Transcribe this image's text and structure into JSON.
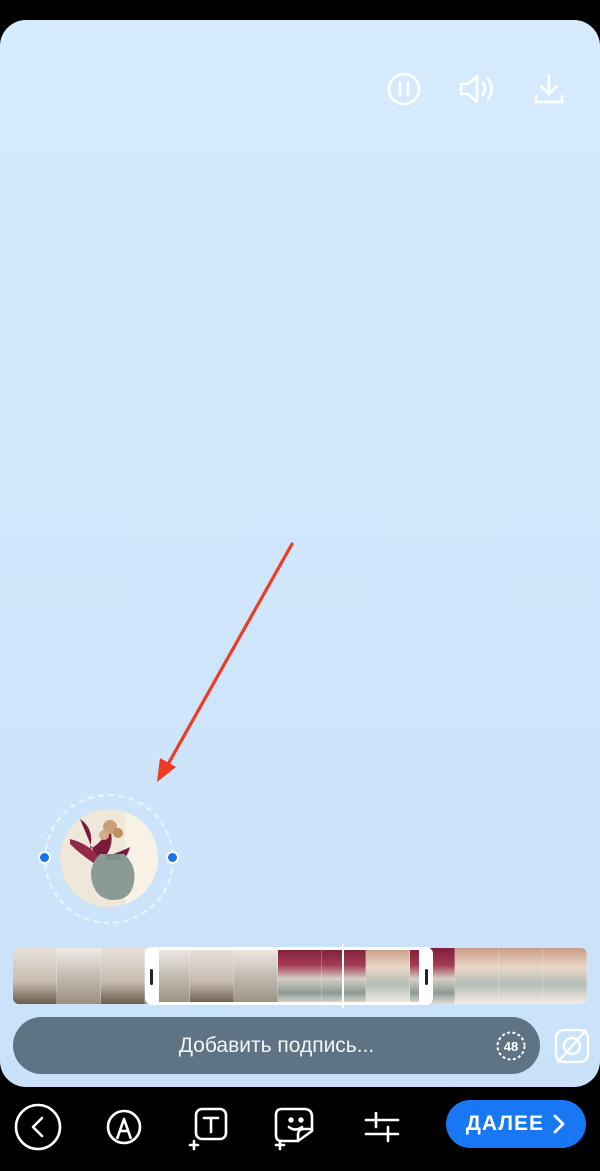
{
  "colors": {
    "canvas_top": "#d6ebfd",
    "canvas_bottom": "#c9e2fa",
    "accent": "#1877f2",
    "arrow": "#ef3a24",
    "caption_bg": "#5e7384"
  },
  "top_controls": [
    "pause-icon",
    "sound-icon",
    "download-icon"
  ],
  "caption": {
    "placeholder": "Добавить подпись...",
    "timer": "48"
  },
  "bottom_toolbar": {
    "tools": [
      "back-icon",
      "draw-icon",
      "text-icon",
      "sticker-icon",
      "adjust-icon"
    ],
    "next_label": "ДАЛЕЕ"
  }
}
